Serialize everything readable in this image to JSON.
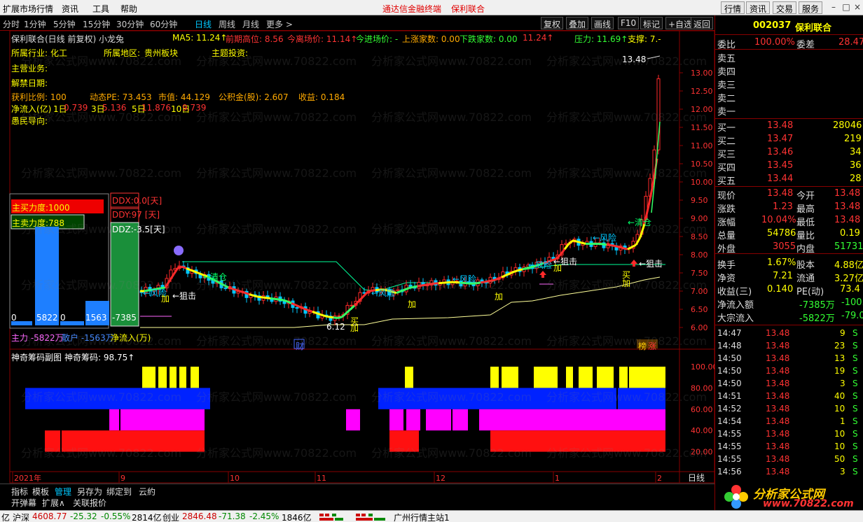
{
  "menu": {
    "items": [
      "扩展市场行情",
      "资讯",
      "工具",
      "帮助"
    ],
    "center_items": [
      "通达信金融终端",
      "保利联合"
    ],
    "right_buttons": [
      "行情",
      "资讯",
      "交易",
      "服务"
    ],
    "window_controls": [
      "–",
      "□",
      "×"
    ]
  },
  "periods": [
    {
      "label": "分时",
      "active": false
    },
    {
      "label": "1分钟",
      "active": false
    },
    {
      "label": "5分钟",
      "active": false
    },
    {
      "label": "15分钟",
      "active": false
    },
    {
      "label": "30分钟",
      "active": false
    },
    {
      "label": "60分钟",
      "active": false
    },
    {
      "label": "日线",
      "active": true
    },
    {
      "label": "周线",
      "active": false
    },
    {
      "label": "月线",
      "active": false
    },
    {
      "label": "更多 >",
      "active": false
    }
  ],
  "toolbar": [
    "复权",
    "叠加",
    "画线",
    "F10",
    "标记",
    "+自选",
    "返回"
  ],
  "title": {
    "name": "保利联合(日线 前复权) 小龙兔",
    "ma5": "MA5: 11.24↑",
    "prev_high": "前期高位: 8.56",
    "exit_price": "今离场价: 11.14↑",
    "entry_price": "今进场价: -",
    "up_count": "上涨家数: 0.00",
    "down_count": "下跌家数: 0.00",
    "tail": "11.24↑",
    "pressure": "压力: 11.69↑",
    "support": "支撑: 7.-"
  },
  "info": {
    "industry_label": "所属行业:",
    "industry": "化工",
    "region_label": "所属地区:",
    "region": "贵州板块",
    "theme_label": "主题投资:",
    "main_business": "主营业务:",
    "unlock_date": "解禁日期:",
    "profit_ratio": "获利比例: 100",
    "pe": "动态PE: 73.453",
    "market_value": "市值: 44.129",
    "fund": "公积金(股): 2.607",
    "income": "收益: 0.184",
    "net_inflow_label": "净流入(亿)",
    "inflow_1": "1日",
    "inflow_1v": "0.739",
    "inflow_3": "3日",
    "inflow_3v": "5.136",
    "inflow_5": "5日",
    "inflow_5v": "11.876",
    "inflow_10": "10日",
    "inflow_10v": "9.739",
    "guide": "愚民导向:"
  },
  "flow_panel": {
    "main_buy": "主买力度:1000",
    "main_sell": "主卖力度:788",
    "bar_labels": [
      "0",
      "5822",
      "0",
      "1563",
      "-7385"
    ],
    "footer_main": "主力 -5822万",
    "footer_retail": "散户 -1563万",
    "footer_net": "净流入(万)",
    "ddx": "DDX:0.0[天]",
    "ddy": "DDY:97 [天]",
    "ddz": "DDZ:-3.5[天]"
  },
  "annotations": {
    "qingcang": "←清仓",
    "fengxian": "←风险",
    "juji": "←狙击",
    "jia": "加",
    "mai": "买",
    "low_label": "6.12",
    "high_label": "13.48",
    "cai": "财",
    "bang": "榜",
    "zhang": "涨"
  },
  "price_axis": [
    "13.00",
    "12.50",
    "12.00",
    "11.50",
    "11.00",
    "10.50",
    "10.00",
    "9.50",
    "9.00",
    "8.50",
    "8.00",
    "7.50",
    "7.00",
    "6.50",
    "6.00"
  ],
  "sub_chart": {
    "title": "神奇筹码副图",
    "value": "神奇筹码: 98.75↑",
    "axis": [
      "100.00",
      "80.00",
      "60.00",
      "40.00",
      "20.00"
    ]
  },
  "time_axis": [
    "2021年",
    "9",
    "10",
    "11",
    "12",
    "1",
    "2"
  ],
  "time_axis_right": "日线",
  "quote": {
    "code": "002037",
    "name": "保利联合",
    "weibi_label": "委比",
    "weibi": "100.00%",
    "weicha_label": "委差",
    "weicha": "28.47",
    "sell": [
      {
        "label": "卖五"
      },
      {
        "label": "卖四"
      },
      {
        "label": "卖三"
      },
      {
        "label": "卖二"
      },
      {
        "label": "卖一"
      }
    ],
    "buy": [
      {
        "label": "买一",
        "price": "13.48",
        "vol": "28046"
      },
      {
        "label": "买二",
        "price": "13.47",
        "vol": "219"
      },
      {
        "label": "买三",
        "price": "13.46",
        "vol": "34"
      },
      {
        "label": "买四",
        "price": "13.45",
        "vol": "36"
      },
      {
        "label": "买五",
        "price": "13.44",
        "vol": "28"
      }
    ],
    "stats": [
      {
        "l1": "现价",
        "v1": "13.48",
        "l2": "今开",
        "v2": "13.48",
        "c1": "#ff3333",
        "c2": "#ff3333"
      },
      {
        "l1": "涨跌",
        "v1": "1.23",
        "l2": "最高",
        "v2": "13.48",
        "c1": "#ff3333",
        "c2": "#ff3333"
      },
      {
        "l1": "涨幅",
        "v1": "10.04%",
        "l2": "最低",
        "v2": "13.48",
        "c1": "#ff3333",
        "c2": "#ff3333"
      },
      {
        "l1": "总量",
        "v1": "54786",
        "l2": "量比",
        "v2": "0.19",
        "c1": "#ffff00",
        "c2": "#ffff00"
      },
      {
        "l1": "外盘",
        "v1": "3055",
        "l2": "内盘",
        "v2": "51731",
        "c1": "#ff3333",
        "c2": "#33ff33"
      },
      {
        "l1": "换手",
        "v1": "1.67%",
        "l2": "股本",
        "v2": "4.88亿",
        "c1": "#ffff00",
        "c2": "#ffff00"
      },
      {
        "l1": "净资",
        "v1": "7.21",
        "l2": "流通",
        "v2": "3.27亿",
        "c1": "#ffff00",
        "c2": "#ffff00"
      },
      {
        "l1": "收益(三)",
        "v1": "0.140",
        "l2": "PE(动)",
        "v2": "73.4",
        "c1": "#ffff00",
        "c2": "#ffff00"
      }
    ],
    "net_inflow_label": "净流入额",
    "net_inflow": "-7385万",
    "net_inflow_pct": "-100.0",
    "big_order_label": "大宗流入",
    "big_order": "-5822万",
    "big_order_pct": "-79.0"
  },
  "ticks": [
    {
      "t": "14:47",
      "p": "13.48",
      "v": "9",
      "d": "S"
    },
    {
      "t": "14:48",
      "p": "13.48",
      "v": "23",
      "d": "S"
    },
    {
      "t": "14:50",
      "p": "13.48",
      "v": "13",
      "d": "S"
    },
    {
      "t": "14:50",
      "p": "13.48",
      "v": "19",
      "d": "S"
    },
    {
      "t": "14:50",
      "p": "13.48",
      "v": "3",
      "d": "S"
    },
    {
      "t": "14:51",
      "p": "13.48",
      "v": "40",
      "d": "S"
    },
    {
      "t": "14:52",
      "p": "13.48",
      "v": "10",
      "d": "S"
    },
    {
      "t": "14:54",
      "p": "13.48",
      "v": "1",
      "d": "S"
    },
    {
      "t": "14:55",
      "p": "13.48",
      "v": "10",
      "d": "S"
    },
    {
      "t": "14:55",
      "p": "13.48",
      "v": "10",
      "d": "S"
    },
    {
      "t": "14:55",
      "p": "13.48",
      "v": "50",
      "d": "S"
    },
    {
      "t": "14:56",
      "p": "13.48",
      "v": "3",
      "d": "S"
    }
  ],
  "bottom_tabs": [
    "指标",
    "模板",
    "管理",
    "另存为",
    "绑定到",
    "云約"
  ],
  "bottom_tabs2": [
    "开弹幕",
    "扩展∧",
    "关联报价"
  ],
  "status": {
    "prefix": "亿",
    "sh_label": "沪深",
    "sh_value": "4608.77",
    "sh_change": "-25.32",
    "sh_pct": "-0.55%",
    "sh_amount": "2814亿",
    "cy_label": "创业",
    "cy_value": "2846.48",
    "cy_change": "-71.38",
    "cy_pct": "-2.45%",
    "cy_amount": "1846亿",
    "server": "广州行情主站1"
  },
  "watermark": "分析家公式网www.70822.com",
  "logo": {
    "title": "分析家公式网",
    "url": "www.70822.com"
  },
  "colors": {
    "up": "#ff2a2a",
    "down": "#00c8ff",
    "label": "#ffff00",
    "accent": "#00c8ff"
  }
}
